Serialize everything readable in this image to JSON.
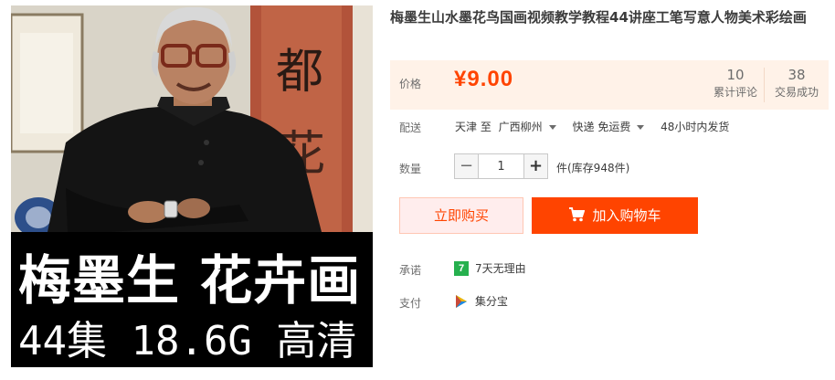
{
  "product": {
    "title": "梅墨生山水墨花鸟国画视频教学教程44讲座工笔写意人物美术彩绘画",
    "image_caption": {
      "line1": "梅墨生 花卉画",
      "line2": "44集 18.6G 高清"
    },
    "image_calligraphy": "都 花"
  },
  "price": {
    "label": "价格",
    "value": "¥9.00",
    "accent_color": "#ff4400",
    "reviews_count": "10",
    "reviews_label": "累计评论",
    "trades_count": "38",
    "trades_label": "交易成功"
  },
  "delivery": {
    "label": "配送",
    "from": "天津 至",
    "to": "广西柳州",
    "shipping": "快递 免运费",
    "dispatch": "48小时内发货"
  },
  "quantity": {
    "label": "数量",
    "minus": "−",
    "value": "1",
    "plus": "+",
    "stock": "件(库存948件)"
  },
  "actions": {
    "buy_now": "立即购买",
    "add_to_cart": "加入购物车"
  },
  "promise": {
    "label": "承诺",
    "icon_text": "7",
    "text": "7天无理由"
  },
  "payment": {
    "label": "支付",
    "text": "集分宝"
  }
}
